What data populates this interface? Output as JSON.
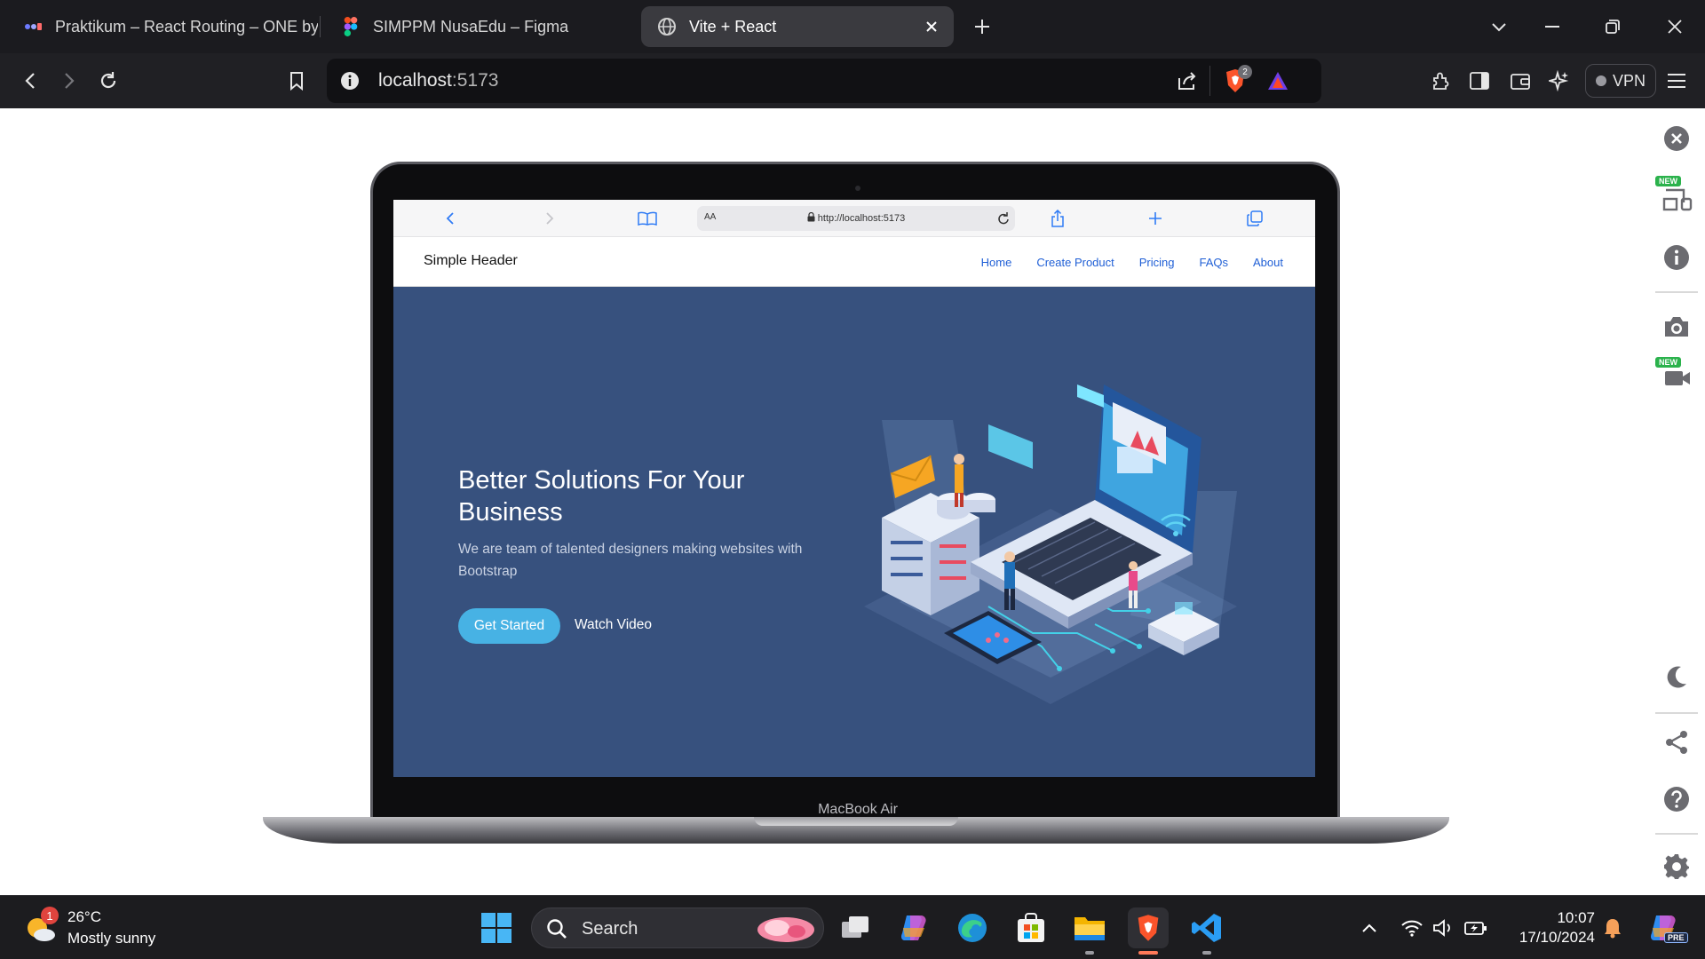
{
  "browser": {
    "tabs": [
      {
        "title": "Praktikum – React Routing – ONE by",
        "active": false
      },
      {
        "title": "SIMPPM NusaEdu – Figma",
        "active": false
      },
      {
        "title": "Vite + React",
        "active": true
      }
    ],
    "url_host": "localhost",
    "url_port": ":5173",
    "shield_count": "2",
    "vpn_label": "VPN"
  },
  "device": {
    "label": "MacBook Air",
    "safari": {
      "text_size_label": "AA",
      "url": "http://localhost:5173"
    }
  },
  "app": {
    "brand": "Simple Header",
    "nav": [
      {
        "label": "Home"
      },
      {
        "label": "Create Product"
      },
      {
        "label": "Pricing"
      },
      {
        "label": "FAQs"
      },
      {
        "label": "About"
      }
    ],
    "hero": {
      "title": "Better Solutions For Your Business",
      "subtitle": "We are team of talented designers making websites with Bootstrap",
      "primary_cta": "Get Started",
      "secondary_cta": "Watch Video"
    }
  },
  "side_tools": {
    "new_badge": "NEW"
  },
  "taskbar": {
    "weather_temp": "26°C",
    "weather_desc": "Mostly sunny",
    "weather_badge": "1",
    "search_label": "Search",
    "time": "10:07",
    "date": "17/10/2024",
    "copilot_badge": "PRE"
  },
  "colors": {
    "hero_bg": "#37517e",
    "cta": "#47b2e4",
    "nav_link": "#1f5fd6",
    "brave_orange": "#fb542b"
  }
}
